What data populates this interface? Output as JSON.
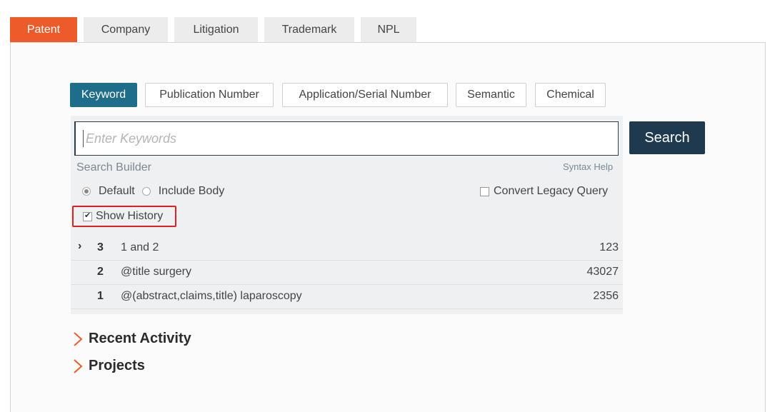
{
  "tabs": [
    {
      "label": "Patent",
      "active": true
    },
    {
      "label": "Company",
      "active": false
    },
    {
      "label": "Litigation",
      "active": false
    },
    {
      "label": "Trademark",
      "active": false
    },
    {
      "label": "NPL",
      "active": false
    }
  ],
  "search_types": [
    {
      "label": "Keyword",
      "active": true
    },
    {
      "label": "Publication Number",
      "active": false
    },
    {
      "label": "Application/Serial Number",
      "active": false
    },
    {
      "label": "Semantic",
      "active": false
    },
    {
      "label": "Chemical",
      "active": false
    }
  ],
  "search": {
    "placeholder": "Enter Keywords",
    "value": "",
    "button_label": "Search",
    "builder_label": "Search Builder",
    "syntax_help_label": "Syntax Help"
  },
  "options": {
    "default_label": "Default",
    "default_checked": true,
    "include_body_label": "Include Body",
    "include_body_checked": false,
    "convert_legacy_label": "Convert Legacy Query",
    "convert_legacy_checked": false,
    "show_history_label": "Show History",
    "show_history_checked": true
  },
  "history": [
    {
      "num": "3",
      "query": "1 and 2",
      "count": "123",
      "expandable": true
    },
    {
      "num": "2",
      "query": "@title surgery",
      "count": "43027",
      "expandable": false
    },
    {
      "num": "1",
      "query": "@(abstract,claims,title) laparoscopy",
      "count": "2356",
      "expandable": false
    }
  ],
  "sections": {
    "recent_activity": "Recent Activity",
    "projects": "Projects"
  },
  "colors": {
    "accent_orange": "#ec5c2a",
    "keyword_blue": "#1e6d8a",
    "search_button": "#1f3a4e",
    "highlight_red": "#e02020"
  },
  "icons": {
    "expand": "chevron-right-icon",
    "section": "chevron-right-outline-icon"
  }
}
